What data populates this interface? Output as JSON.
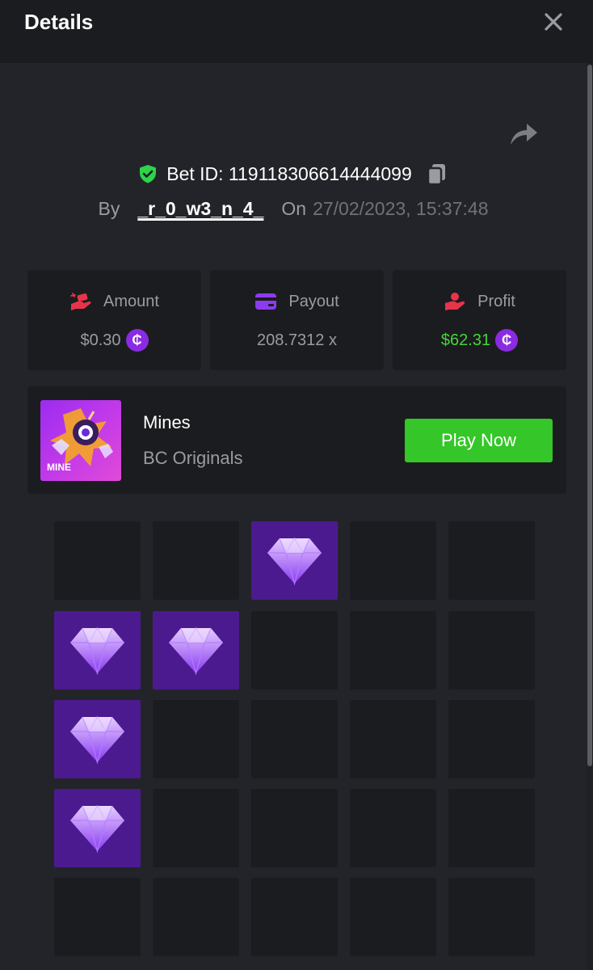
{
  "header": {
    "title": "Details"
  },
  "bet": {
    "id_label": "Bet ID: 119118306614444099",
    "by_label": "By",
    "username": "_r_0_w3_n_4_",
    "on_label": "On",
    "datetime": "27/02/2023, 15:37:48"
  },
  "stats": [
    {
      "label": "Amount",
      "value": "$0.30",
      "icon": "hand-money-icon"
    },
    {
      "label": "Payout",
      "value": "208.7312 x",
      "icon": "wallet-card-icon"
    },
    {
      "label": "Profit",
      "value": "$62.31",
      "icon": "hand-coins-icon"
    }
  ],
  "coin_symbol": "₵",
  "game": {
    "name": "Mines",
    "provider": "BC Originals",
    "thumb_text": "MINE",
    "play_label": "Play Now"
  },
  "board": {
    "rows": 5,
    "cols": 5,
    "gems": [
      [
        0,
        2
      ],
      [
        1,
        0
      ],
      [
        1,
        1
      ],
      [
        2,
        0
      ],
      [
        3,
        0
      ]
    ]
  },
  "colors": {
    "accent_green": "#35c629",
    "profit_green": "#44d637",
    "coin_purple": "#8a2be2",
    "gem_tile": "#4c1a8f",
    "shield_green": "#2fd24a",
    "icon_red": "#e8344a",
    "icon_purple": "#8b3cf0"
  }
}
